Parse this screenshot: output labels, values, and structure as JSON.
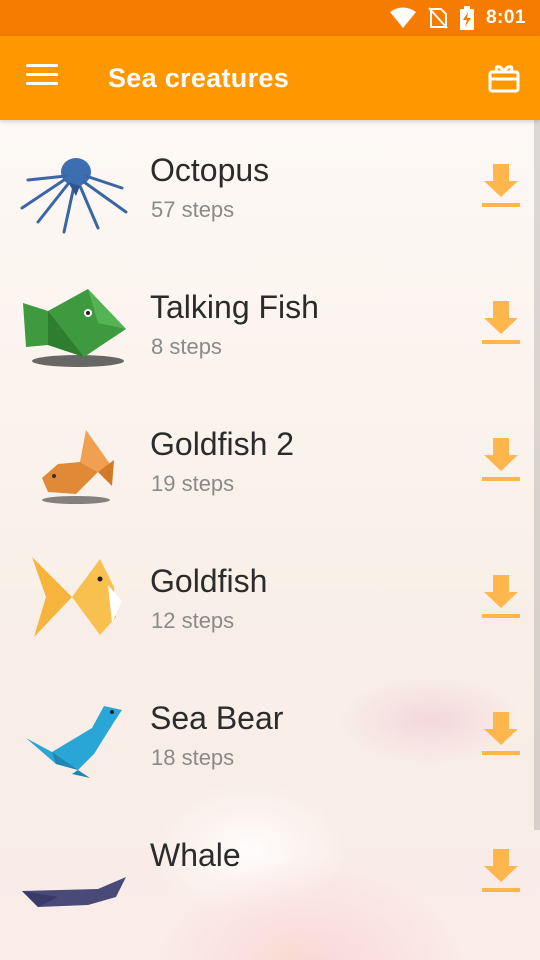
{
  "status_bar": {
    "time": "8:01"
  },
  "app_bar": {
    "title": "Sea creatures"
  },
  "items": [
    {
      "name": "Octopus",
      "steps": "57 steps"
    },
    {
      "name": "Talking Fish",
      "steps": "8 steps"
    },
    {
      "name": "Goldfish 2",
      "steps": "19 steps"
    },
    {
      "name": "Goldfish",
      "steps": "12 steps"
    },
    {
      "name": "Sea Bear",
      "steps": "18 steps"
    },
    {
      "name": "Whale",
      "steps": ""
    }
  ],
  "icons": {
    "status": [
      "wifi-icon",
      "no-sim-icon",
      "battery-charging-icon"
    ],
    "app_bar": [
      "menu-icon",
      "gift-icon"
    ],
    "row_action": "download-icon"
  },
  "colors": {
    "status_bar": "#f57c00",
    "app_bar": "#ff9800",
    "download": "#ffb74d"
  }
}
